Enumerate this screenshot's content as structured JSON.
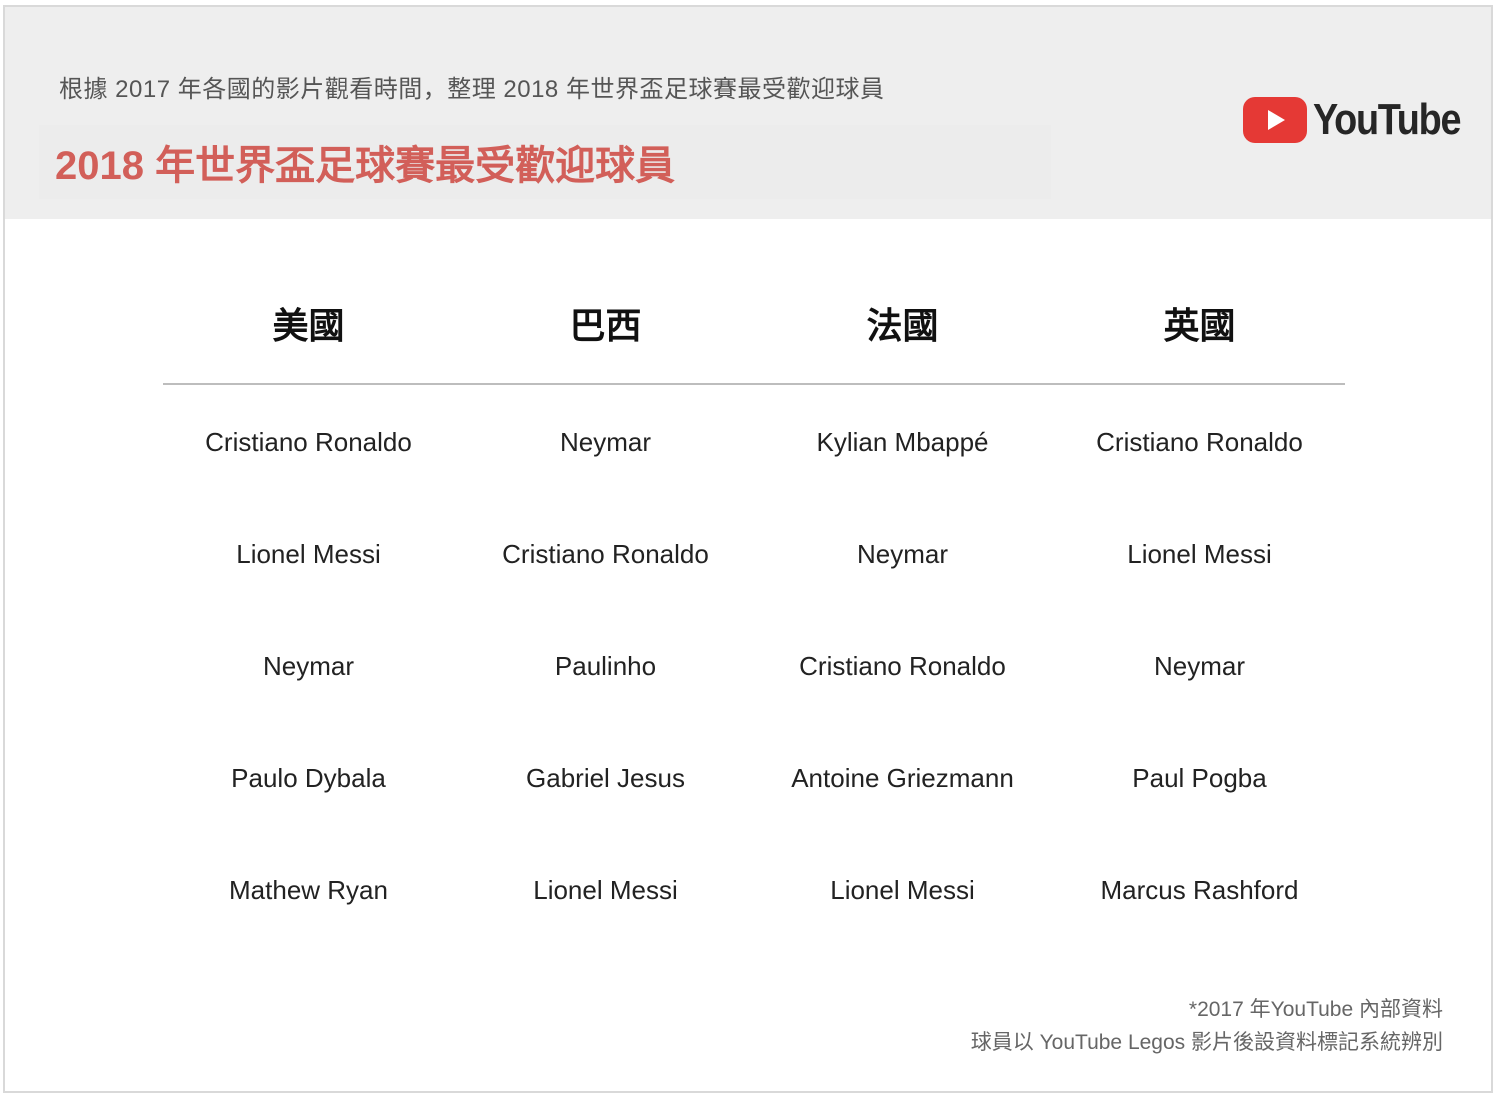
{
  "header": {
    "subtitle": "根據 2017 年各國的影片觀看時間，整理 2018 年世界盃足球賽最受歡迎球員",
    "title": "2018 年世界盃足球賽最受歡迎球員",
    "brand": "YouTube",
    "brand_icon": "youtube-play-icon",
    "title_color": "#d25f59",
    "brand_color": "#e53935"
  },
  "table": {
    "columns": [
      "美國",
      "巴西",
      "法國",
      "英國"
    ],
    "rows": [
      [
        "Cristiano Ronaldo",
        "Neymar",
        "Kylian Mbappé",
        "Cristiano Ronaldo"
      ],
      [
        "Lionel Messi",
        "Cristiano Ronaldo",
        "Neymar",
        "Lionel Messi"
      ],
      [
        "Neymar",
        "Paulinho",
        "Cristiano Ronaldo",
        "Neymar"
      ],
      [
        "Paulo Dybala",
        "Gabriel Jesus",
        "Antoine Griezmann",
        "Paul Pogba"
      ],
      [
        "Mathew Ryan",
        "Lionel Messi",
        "Lionel Messi",
        "Marcus Rashford"
      ]
    ]
  },
  "footnote": {
    "line1": "*2017 年YouTube 內部資料",
    "line2": "球員以 YouTube Legos 影片後設資料標記系統辨別"
  }
}
